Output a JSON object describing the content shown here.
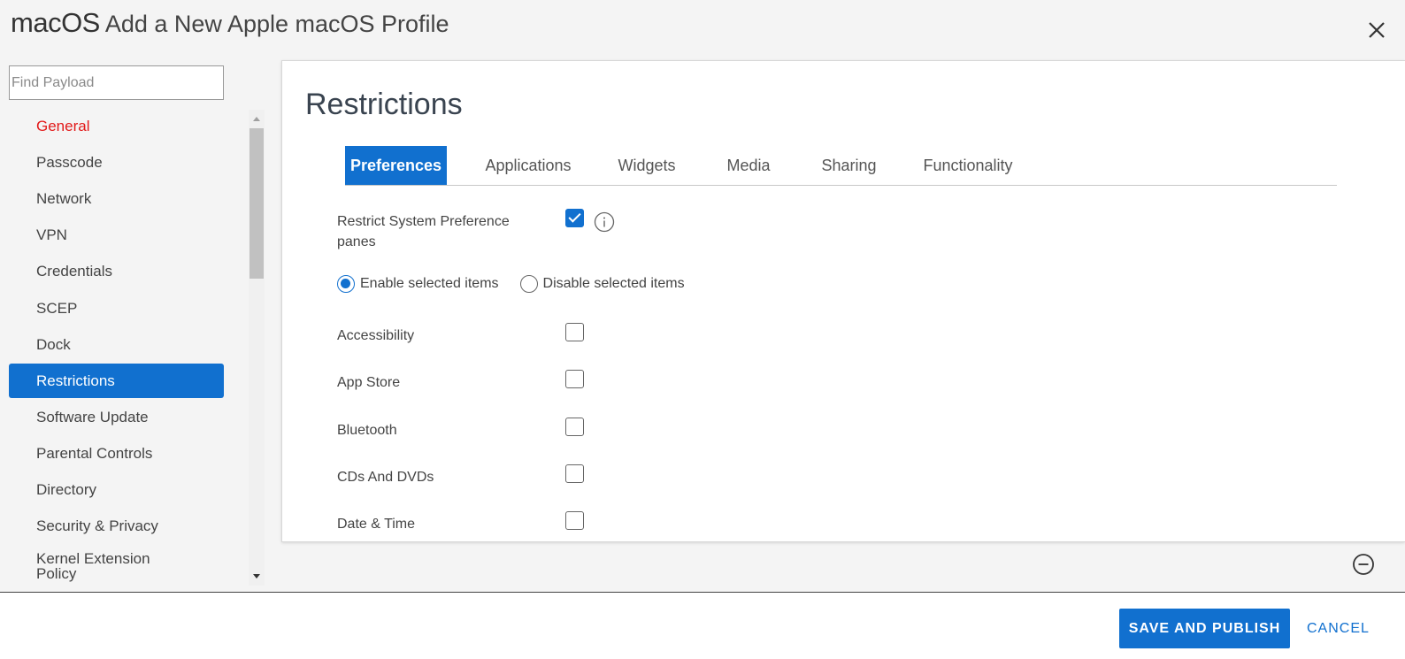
{
  "header": {
    "platform": "macOS",
    "title": "Add a New Apple macOS Profile"
  },
  "search": {
    "placeholder": "Find Payload"
  },
  "sidebar": {
    "items": [
      {
        "label": "General"
      },
      {
        "label": "Passcode"
      },
      {
        "label": "Network"
      },
      {
        "label": "VPN"
      },
      {
        "label": "Credentials"
      },
      {
        "label": "SCEP"
      },
      {
        "label": "Dock"
      },
      {
        "label": "Restrictions"
      },
      {
        "label": "Software Update"
      },
      {
        "label": "Parental Controls"
      },
      {
        "label": "Directory"
      },
      {
        "label": "Security & Privacy"
      },
      {
        "label": "Kernel Extension Policy"
      }
    ],
    "active": "Restrictions"
  },
  "panel": {
    "title": "Restrictions",
    "tabs": [
      {
        "label": "Preferences"
      },
      {
        "label": "Applications"
      },
      {
        "label": "Widgets"
      },
      {
        "label": "Media"
      },
      {
        "label": "Sharing"
      },
      {
        "label": "Functionality"
      }
    ],
    "active_tab": "Preferences",
    "restrict_label": "Restrict System Preference panes",
    "restrict_checked": true,
    "radio": {
      "enable_label": "Enable selected items",
      "disable_label": "Disable selected items",
      "selected": "enable"
    },
    "items": [
      {
        "label": "Accessibility",
        "checked": false
      },
      {
        "label": "App Store",
        "checked": false
      },
      {
        "label": "Bluetooth",
        "checked": false
      },
      {
        "label": "CDs And DVDs",
        "checked": false
      },
      {
        "label": "Date & Time",
        "checked": false
      }
    ]
  },
  "footer": {
    "save_label": "SAVE AND PUBLISH",
    "cancel_label": "CANCEL"
  },
  "colors": {
    "accent": "#1170cf",
    "general_red": "#e21a1a"
  }
}
